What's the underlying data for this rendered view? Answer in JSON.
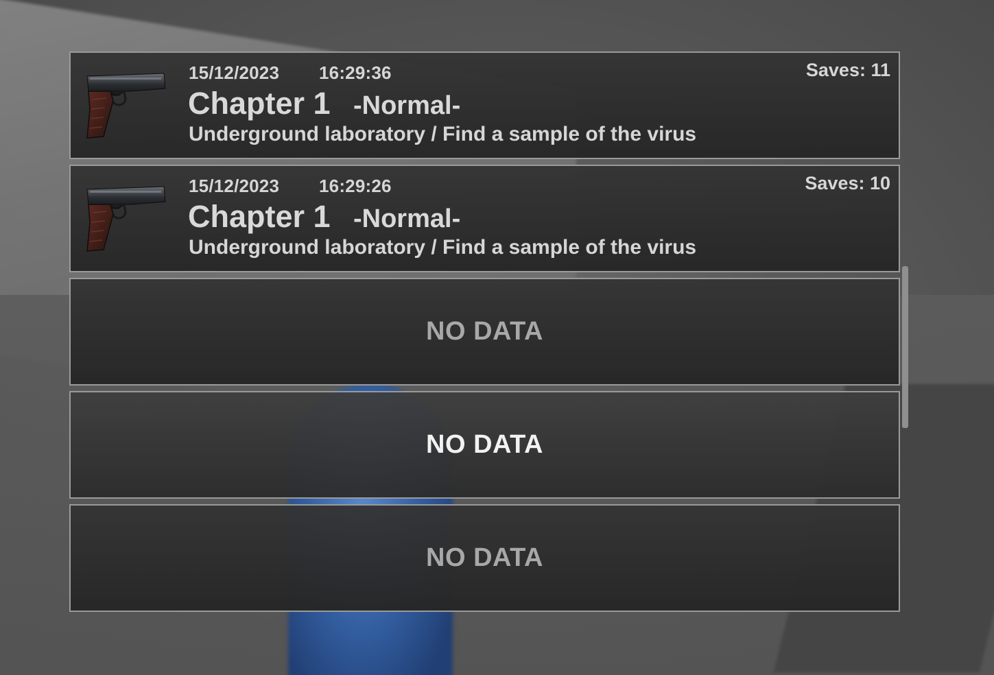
{
  "save_slots": [
    {
      "state": "filled",
      "thumbnail": "pistol-icon",
      "date": "15/12/2023",
      "time": "16:29:36",
      "saves": "Saves: 11",
      "chapter": "Chapter 1",
      "difficulty": "-Normal-",
      "location": "Underground laboratory / Find a sample of the virus"
    },
    {
      "state": "filled",
      "thumbnail": "pistol-icon",
      "date": "15/12/2023",
      "time": "16:29:26",
      "saves": "Saves: 10",
      "chapter": "Chapter 1",
      "difficulty": "-Normal-",
      "location": "Underground laboratory / Find a sample of the virus"
    },
    {
      "state": "empty",
      "label": "NO DATA"
    },
    {
      "state": "empty",
      "label": "NO DATA",
      "selected": true
    },
    {
      "state": "empty",
      "label": "NO DATA"
    }
  ],
  "colors": {
    "panel_bg": "#2e2e2e",
    "panel_border": "#9a9a9a",
    "text": "#d6d6d6",
    "empty_text": "#a8a8a8",
    "selected_text": "#f2f2f2",
    "scrollbar": "#8f8f8f"
  }
}
